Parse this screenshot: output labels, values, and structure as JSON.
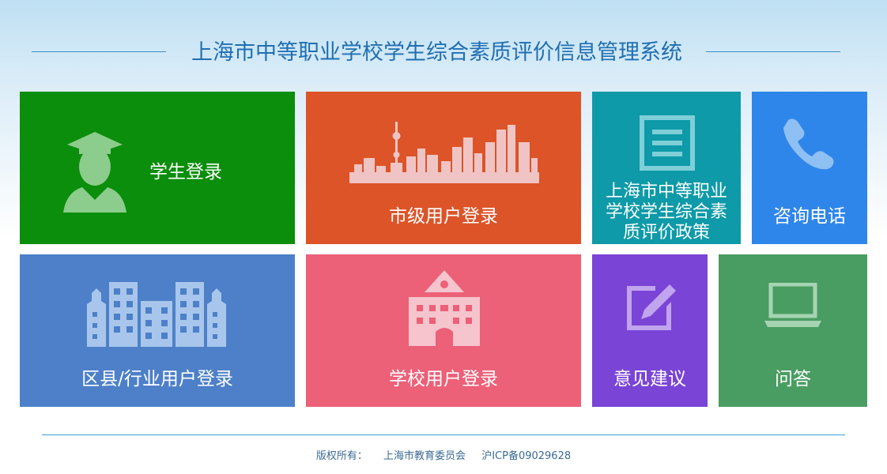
{
  "header": {
    "title": "上海市中等职业学校学生综合素质评价信息管理系统"
  },
  "tiles": {
    "student": {
      "label": "学生登录",
      "color": "#0b8e0b"
    },
    "city": {
      "label": "市级用户登录",
      "color": "#dc5428"
    },
    "policy": {
      "label": "上海市中等职业学校学生综合素质评价政策",
      "lines": [
        "上海市中等职业",
        "学校学生综合素",
        "质评价政策"
      ],
      "color": "#0e9aa8"
    },
    "hotline": {
      "label": "咨询电话",
      "color": "#2f86ea"
    },
    "district": {
      "label": "区县/行业用户登录",
      "color": "#4d80c8"
    },
    "school": {
      "label": "学校用户登录",
      "color": "#ec6078"
    },
    "feedback": {
      "label": "意见建议",
      "color": "#7a44d6"
    },
    "qa": {
      "label": "问答",
      "color": "#4a9d62"
    }
  },
  "footer": {
    "copyright_label": "版权所有：",
    "owner": "上海市教育委员会",
    "icp": "沪ICP备09029628"
  },
  "icons": {
    "student": "graduate-student-icon",
    "city": "city-skyline-icon",
    "policy": "document-icon",
    "hotline": "phone-icon",
    "district": "buildings-icon",
    "school": "school-building-icon",
    "feedback": "edit-pencil-icon",
    "qa": "laptop-icon"
  }
}
